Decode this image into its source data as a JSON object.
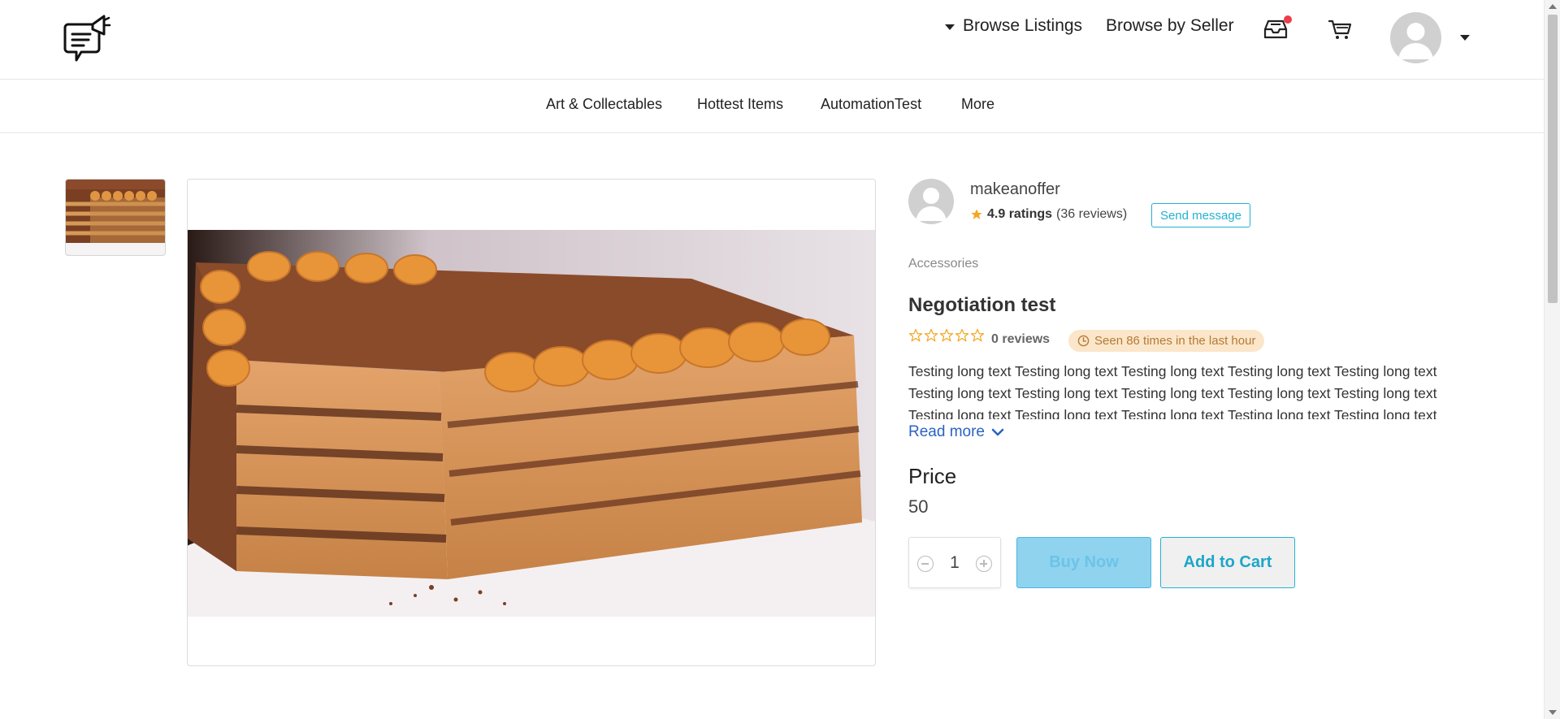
{
  "header": {
    "browse_listings": "Browse Listings",
    "browse_by_seller": "Browse by Seller",
    "icons": [
      "chat-megaphone-logo-icon",
      "inbox-icon",
      "cart-icon",
      "avatar-icon",
      "caret-down-icon"
    ],
    "notification_dot_color": "#ef3b4b"
  },
  "categories": [
    "Art & Collectables",
    "Hottest Items",
    "AutomationTest",
    "More"
  ],
  "seller": {
    "name": "makeanoffer",
    "rating": "4.9 ratings",
    "reviews": "(36 reviews)",
    "send_message": "Send message"
  },
  "product": {
    "category": "Accessories",
    "title": "Negotiation test",
    "star_count": 5,
    "filled_stars": 0,
    "reviews": "0 reviews",
    "seen": "Seen 86 times in the last hour",
    "description": "Testing long text Testing long text Testing long text Testing long text Testing long text Testing long text Testing long text Testing long text Testing long text Testing long text Testing long text Testing long text Testing long text Testing long text Testing long text",
    "read_more": "Read more",
    "price_label": "Price",
    "price_value": "50",
    "quantity": "1",
    "buy_now": "Buy Now",
    "add_to_cart": "Add to Cart"
  },
  "colors": {
    "accent": "#23b1d1",
    "link": "#2a63c3",
    "star": "#f5a623",
    "badge_bg": "#fbe6c9",
    "badge_text": "#b37b38",
    "buy_now_bg": "#8fd3ef"
  }
}
